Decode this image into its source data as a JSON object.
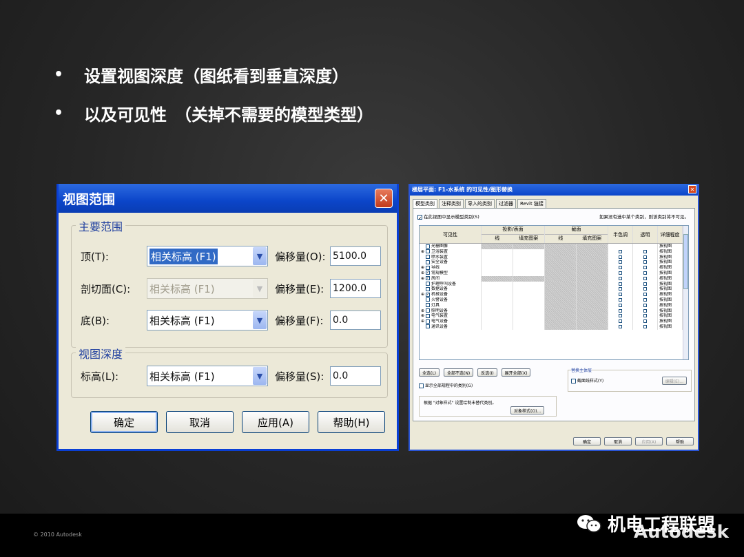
{
  "slide": {
    "bullets": [
      "设置视图深度（图纸看到垂直深度）",
      "以及可见性　（关掉不需要的模型类型）"
    ],
    "bullet_symbol": "•"
  },
  "view_range_dialog": {
    "title": "视图范围",
    "close": "✕",
    "primary_group": "主要范围",
    "depth_group": "视图深度",
    "rows": [
      {
        "label": "顶(T):",
        "combo": "相关标高 (F1)",
        "offset_label": "偏移量(O):",
        "offset": "5100.0"
      },
      {
        "label": "剖切面(C):",
        "combo": "相关标高 (F1)",
        "offset_label": "偏移量(E):",
        "offset": "1200.0"
      },
      {
        "label": "底(B):",
        "combo": "相关标高 (F1)",
        "offset_label": "偏移量(F):",
        "offset": "0.0"
      }
    ],
    "depth_row": {
      "label": "标高(L):",
      "combo": "相关标高 (F1)",
      "offset_label": "偏移量(S):",
      "offset": "0.0"
    },
    "buttons": [
      "确定",
      "取消",
      "应用(A)",
      "帮助(H)"
    ]
  },
  "vg_dialog": {
    "title": "楼层平面: F1-水系统 的可见性/图形替换",
    "close": "✕",
    "tabs": [
      "模型类别",
      "注释类别",
      "导入的类别",
      "过滤器",
      "Revit 链接"
    ],
    "show_models": "在此视图中显示模型类别(S)",
    "hint": "如果没有选中某个类别，则该类别将不可见。",
    "headers": {
      "visibility": "可见性",
      "proj_surface": "投影/表面",
      "cut": "截面",
      "line": "线",
      "fill": "填充图案",
      "halftone": "半色调",
      "transparent": "透明",
      "detail": "详细程度"
    },
    "categories": [
      {
        "name": "光栅图像",
        "expand": "",
        "checked": false
      },
      {
        "name": "卫浴装置",
        "expand": "⊕",
        "checked": false
      },
      {
        "name": "喷水装置",
        "expand": "",
        "checked": false
      },
      {
        "name": "安全设备",
        "expand": "",
        "checked": false
      },
      {
        "name": "导线",
        "expand": "⊕",
        "checked": false
      },
      {
        "name": "常规模型",
        "expand": "⊕",
        "checked": true
      },
      {
        "name": "房间",
        "expand": "⊕",
        "checked": true
      },
      {
        "name": "护理呼叫设备",
        "expand": "",
        "checked": false
      },
      {
        "name": "数据设备",
        "expand": "",
        "checked": false
      },
      {
        "name": "机械设备",
        "expand": "⊕",
        "checked": true
      },
      {
        "name": "火警设备",
        "expand": "",
        "checked": false
      },
      {
        "name": "灯具",
        "expand": "",
        "checked": false
      },
      {
        "name": "照明设备",
        "expand": "⊕",
        "checked": false
      },
      {
        "name": "电气装置",
        "expand": "⊕",
        "checked": false
      },
      {
        "name": "电气设备",
        "expand": "⊕",
        "checked": false
      },
      {
        "name": "通讯设备",
        "expand": "",
        "checked": false
      }
    ],
    "detail_value": "按视图",
    "list_buttons": [
      "全选(L)",
      "全部不选(N)",
      "反选(I)",
      "展开全部(X)"
    ],
    "override_group": "替换主体层",
    "cut_line_styles": "截面线样式(Y)",
    "edit_button": "编辑(E)...",
    "show_categories": "显示全部规程中的类别(G)",
    "object_style_note": "根据 \"对象样式\" 设置绘制未替代类别。",
    "object_style_button": "对象样式(O)...",
    "bottom_buttons": [
      "确定",
      "取消",
      "应用(A)",
      "帮助"
    ]
  },
  "footer": {
    "copyright": "© 2010 Autodesk",
    "brand": "Autodesk",
    "watermark": "机电工程联盟"
  }
}
